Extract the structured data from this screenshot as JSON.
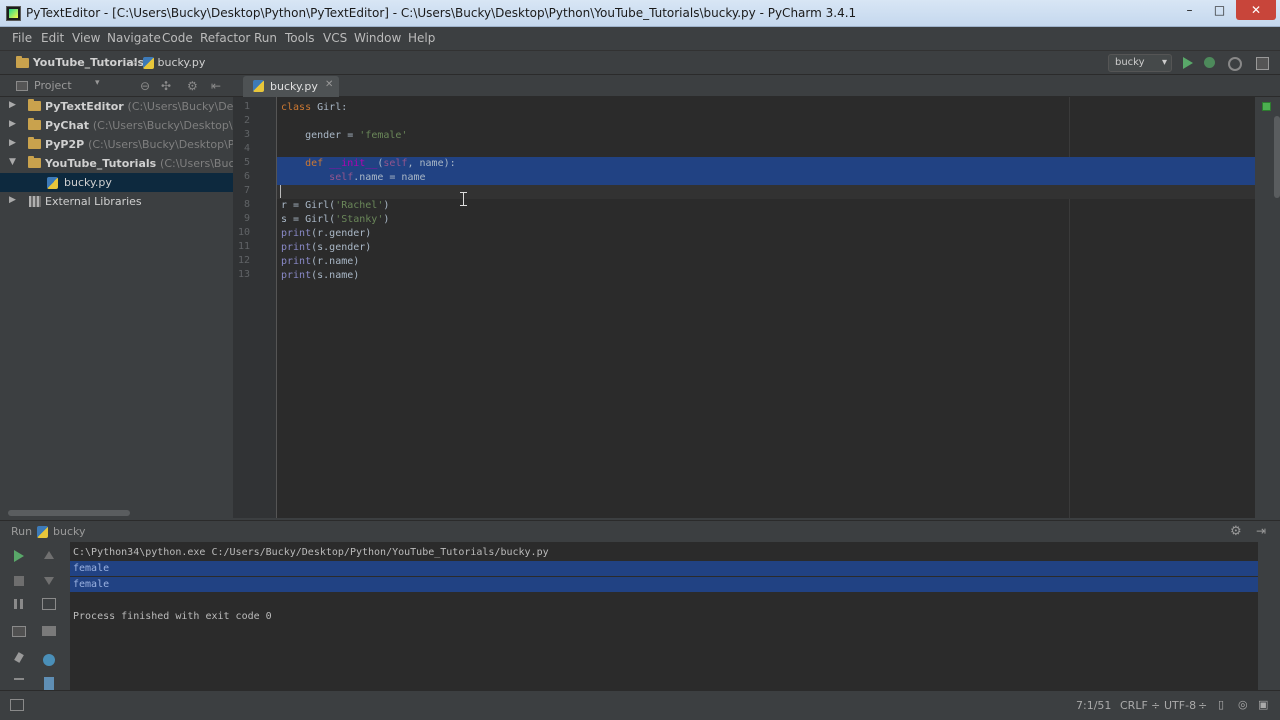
{
  "window": {
    "title": "PyTextEditor - [C:\\Users\\Bucky\\Desktop\\Python\\PyTextEditor] - C:\\Users\\Bucky\\Desktop\\Python\\YouTube_Tutorials\\bucky.py - PyCharm 3.4.1",
    "minimize": "–",
    "maximize": "□",
    "close": "✕"
  },
  "menu": [
    "File",
    "Edit",
    "View",
    "Navigate",
    "Code",
    "Refactor",
    "Run",
    "Tools",
    "VCS",
    "Window",
    "Help"
  ],
  "breadcrumb": {
    "project": "YouTube_Tutorials",
    "separator": "›",
    "file": "bucky.py"
  },
  "run_config": {
    "name": "bucky",
    "chevron": "▾"
  },
  "project_panel": {
    "label": "Project",
    "dropdown": "▾",
    "tools": [
      "⊖",
      "✣",
      "⚙",
      "⇤"
    ],
    "tree": [
      {
        "arrow": "▶",
        "name": "PyTextEditor",
        "path": "(C:\\Users\\Bucky\\Deskto"
      },
      {
        "arrow": "▶",
        "name": "PyChat",
        "path": "(C:\\Users\\Bucky\\Desktop\\Pyt"
      },
      {
        "arrow": "▶",
        "name": "PyP2P",
        "path": "(C:\\Users\\Bucky\\Desktop\\Pyth"
      },
      {
        "arrow": "▼",
        "name": "YouTube_Tutorials",
        "path": "(C:\\Users\\Bucky\\D"
      },
      {
        "arrow": "",
        "name": "bucky.py",
        "path": ""
      },
      {
        "arrow": "▶",
        "name": "External Libraries",
        "path": ""
      }
    ]
  },
  "editor": {
    "tab": {
      "label": "bucky.py",
      "close": "✕"
    },
    "line_numbers": [
      "1",
      "2",
      "3",
      "4",
      "5",
      "6",
      "7",
      "8",
      "9",
      "10",
      "11",
      "12",
      "13"
    ]
  },
  "run_panel": {
    "label": "Run",
    "file": "bucky",
    "settings_icon": "⚙",
    "hide_icon": "⇥",
    "console": [
      "C:\\Python34\\python.exe C:/Users/Bucky/Desktop/Python/YouTube_Tutorials/bucky.py",
      "female",
      "female",
      "",
      "Process finished with exit code 0"
    ]
  },
  "status": {
    "position": "7:1/51",
    "line_separator": "CRLF",
    "line_separator_chevron": "÷",
    "encoding": "UTF-8",
    "encoding_chevron": "÷"
  },
  "colors": {
    "editor_bg": "#2b2b2b",
    "selection": "#214283",
    "keyword": "#cc7832",
    "string": "#6a8759",
    "self": "#94558d",
    "builtin": "#8888c6"
  }
}
